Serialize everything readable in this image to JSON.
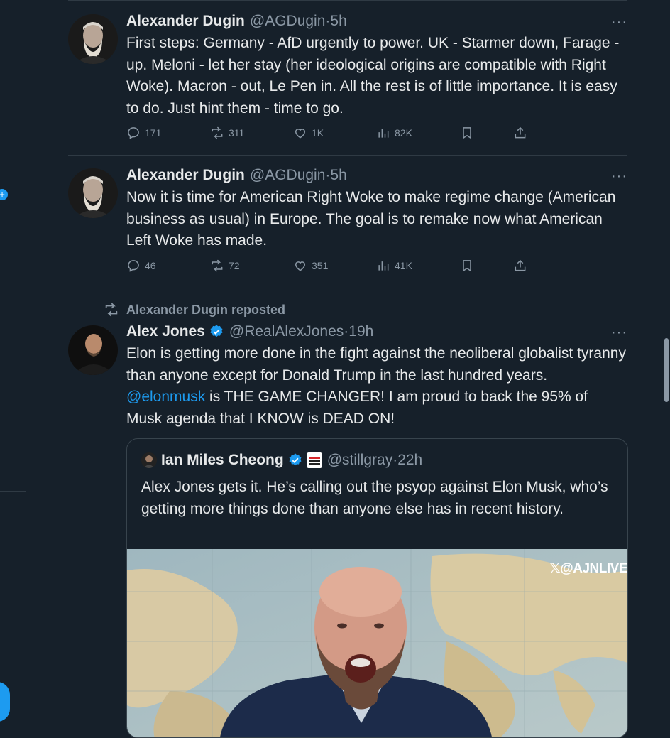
{
  "tweets": [
    {
      "name": "Alexander Dugin",
      "handle": "@AGDugin",
      "dot": "·",
      "time": "5h",
      "more": "···",
      "text": "First steps: Germany - AfD urgently to power. UK - Starmer down, Farage -  up. Meloni - let her stay (her ideological origins are compatible with Right Woke). Macron - out, Le Pen in. All the rest is of little importance. It is easy to do. Just hint them - time to go.",
      "stats": {
        "replies": "171",
        "reposts": "311",
        "likes": "1K",
        "views": "82K"
      }
    },
    {
      "name": "Alexander Dugin",
      "handle": "@AGDugin",
      "dot": "·",
      "time": "5h",
      "more": "···",
      "text": "Now it is time for American Right Woke to make regime change (American business as usual) in Europe. The goal is to remake now what American Left Woke has made.",
      "stats": {
        "replies": "46",
        "reposts": "72",
        "likes": "351",
        "views": "41K"
      }
    },
    {
      "repost_label": "Alexander Dugin reposted",
      "name": "Alex Jones",
      "handle": "@RealAlexJones",
      "dot": "·",
      "time": "19h",
      "more": "···",
      "text_before": "Elon is getting more done in the fight against the neoliberal globalist tyranny than anyone except for Donald Trump in the last hundred years. ",
      "mention": "@elonmusk",
      "text_after": " is THE GAME CHANGER! I am proud to back the 95% of Musk agenda that I KNOW is DEAD ON!",
      "quote": {
        "name": "Ian Miles Cheong",
        "handle": "@stillgray",
        "dot": "·",
        "time": "22h",
        "text": "Alex Jones gets it. He’s calling out the psyop against Elon Musk, who’s getting more things done than anyone else has in recent history.",
        "watermark": "𝕏@AJNLIVE"
      }
    }
  ],
  "colors": {
    "background": "#16202a",
    "accent": "#1d9bf0",
    "muted": "#8b98a5"
  }
}
